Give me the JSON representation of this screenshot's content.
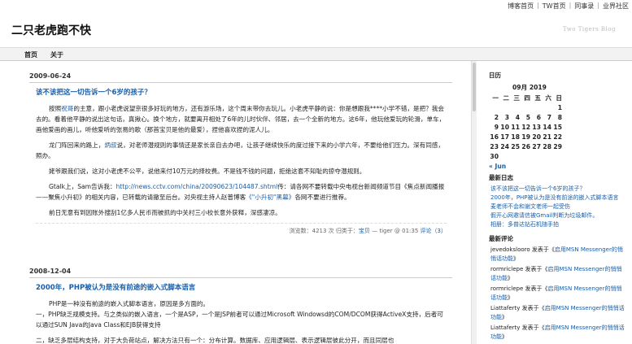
{
  "topnav": [
    "博客首页",
    "TW首页",
    "同事录",
    "业界社区"
  ],
  "site": {
    "title": "二只老虎跑不快",
    "tagline": "Two Tigers Blog"
  },
  "nav": [
    "首页",
    "关于"
  ],
  "posts": [
    {
      "date": "2009-06-24",
      "title": "该不该把这一切告诉一个6岁的孩子？",
      "p1_a": "按照",
      "p1_link": "祝哥",
      "p1_b": "的主意，跟小老虎说望京很多好玩的地方，还有游乐场，这个周末带你去玩儿。小老虎平静的说：你是想跟我****小学不错，是把？我会去的。看着他平静的说出这句话，真揪心。换个地方，就要离开相处了6年的儿时伙伴、邻居，去一个全新的地方。这6年，他玩他爱玩的轮滑，单车，画他爱画的画儿，听他爱听的张易的歌（那首宝贝是他的最爱），捏他喜欢捏的泥人儿。",
      "p2_a": "龙门阵回来的路上，",
      "p2_link": "炳叔",
      "p2_b": "说，对老师潜规则的事情还是家长亲自去办吧，让孩子继续快乐的度过接下来的小学六年，不要给他们压力。深有同感，照办。",
      "p3": "姥爷跟我们说，这对小老虎不公平，说他来付10万元的择校费。不是钱不钱的问题，拒绝这套不知耻的掠夺潜规则。",
      "p4_a": "Gtalk上，Sam告诉我：",
      "p4_link": "http://news.cctv.com/china/20090623/104487.shtml",
      "p4_b": "传：请各网不要转载中央电视台新闻频道节目《焦点新闻播报——聚焦小升初》的相关内容，已转载的请撤至后台。对央视主持人赵普博客",
      "p4_link2": "《\"小升初\"黑幕》",
      "p4_c": "各网不要进行推荐。",
      "p5": "前日无意有到因账外搜刮1亿多人民币而被抓的中关村三小校长意外获释，深感凄凉。",
      "meta_a": "浏览数：4213 次 归类于：",
      "meta_cat": "宝贝",
      "meta_b": " — tiger @ 01:35 ",
      "meta_comments": "评论（3）"
    },
    {
      "date": "2008-12-04",
      "title": "2000年，PHP被认为是没有前途的嵌入式脚本语言",
      "l1": "PHP是一种没有前途的嵌入式脚本语言，原因是多方面的。",
      "l2": "一，PHP缺乏规模支持。与之类似的嵌入语言，一个是ASP，一个是JSP前者可以通过Microsoft Windowsd的COM/DCOM获得ActiveX支持，后者可以通过SUN Java的Java Class和EJB获得支持",
      "l3": "二，缺乏多层结构支持，对于大负荷站点，解决方法只有一个：分布计算。数据库、应用逻辑层、表示逻辑层彼此分开，而且同层也"
    }
  ],
  "sidebar": {
    "calendar_heading": "日历",
    "calendar": {
      "caption": "09月 2019",
      "weekdays": [
        "一",
        "二",
        "三",
        "四",
        "五",
        "六",
        "日"
      ],
      "weeks": [
        [
          "",
          "",
          "",
          "",
          "",
          "",
          "1"
        ],
        [
          "2",
          "3",
          "4",
          "5",
          "6",
          "7",
          "8"
        ],
        [
          "9",
          "10",
          "11",
          "12",
          "13",
          "14",
          "15"
        ],
        [
          "16",
          "17",
          "18",
          "19",
          "20",
          "21",
          "22"
        ],
        [
          "23",
          "24",
          "25",
          "26",
          "27",
          "28",
          "29"
        ],
        [
          "30",
          "",
          "",
          "",
          "",
          "",
          ""
        ]
      ],
      "prev": "« Jun"
    },
    "recent_heading": "最新日志",
    "recent": [
      "该不该把这一切告诉一个6岁的孩子？",
      "2000年，PHP被认为是没有前途的嵌入式脚本语言",
      "麦老师不会和谢文老师一起受伤",
      "假开心网邀请信被Gmail判断为垃圾邮件。",
      "相册：多普达钻石机随手拍"
    ],
    "comments_heading": "最新评论",
    "comments": [
      {
        "author": "jevedokslooro",
        "mid": " 发表于《",
        "post": "启用MSN Messenger的悄悄话功能",
        "end": "》"
      },
      {
        "author": "rormriclepe",
        "mid": " 发表于《",
        "post": "启用MSN Messenger的悄悄话功能",
        "end": "》"
      },
      {
        "author": "rormriclepe",
        "mid": " 发表于《",
        "post": "启用MSN Messenger的悄悄话功能",
        "end": "》"
      },
      {
        "author": "Liattaferty",
        "mid": " 发表于《",
        "post": "启用MSN Messenger的悄悄话功能",
        "end": "》"
      },
      {
        "author": "Liattaferty",
        "mid": " 发表于《",
        "post": "启用MSN Messenger的悄悄话功能",
        "end": "》"
      }
    ]
  }
}
